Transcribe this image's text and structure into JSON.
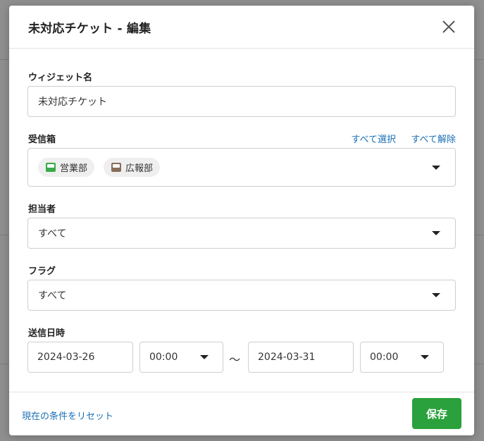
{
  "modal": {
    "title": "未対応チケット - 編集",
    "close_label": "×"
  },
  "widget_name": {
    "label": "ウィジェット名",
    "value": "未対応チケット"
  },
  "inbox": {
    "label": "受信箱",
    "select_all": "すべて選択",
    "deselect_all": "すべて解除",
    "chips": [
      {
        "label": "営業部",
        "color": "#3aaa4a"
      },
      {
        "label": "広報部",
        "color": "#8a6d5a"
      }
    ]
  },
  "assignee": {
    "label": "担当者",
    "value": "すべて"
  },
  "flag": {
    "label": "フラグ",
    "value": "すべて"
  },
  "sent_date": {
    "label": "送信日時",
    "start_date": "2024-03-26",
    "start_time": "00:00",
    "separator": "〜",
    "end_date": "2024-03-31",
    "end_time": "00:00"
  },
  "footer": {
    "reset_label": "現在の条件をリセット",
    "save_label": "保存"
  },
  "colors": {
    "accent_link": "#1b6fb5",
    "save_button": "#2aa13c"
  }
}
